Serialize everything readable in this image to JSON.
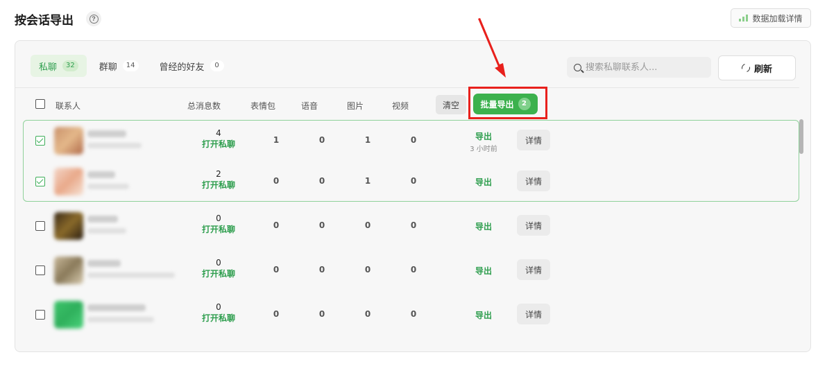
{
  "header": {
    "title": "按会话导出",
    "stats_label": "数据加载详情"
  },
  "tabs": [
    {
      "label": "私聊",
      "count": "32",
      "active": true
    },
    {
      "label": "群聊",
      "count": "14",
      "active": false
    },
    {
      "label": "曾经的好友",
      "count": "0",
      "active": false
    }
  ],
  "search": {
    "placeholder": "搜索私聊联系人..."
  },
  "refresh_label": "刷新",
  "columns": {
    "contact": "联系人",
    "total": "总消息数",
    "stickers": "表情包",
    "voice": "语音",
    "images": "图片",
    "video": "视频"
  },
  "actions": {
    "clear_label": "清空",
    "batch_export_label": "批量导出",
    "batch_count": "2"
  },
  "rows": [
    {
      "checked": true,
      "total": "4",
      "open_label": "打开私聊",
      "stickers": "1",
      "voice": "0",
      "images": "1",
      "video": "0",
      "export_label": "导出",
      "time": "3 小时前",
      "detail_label": "详情"
    },
    {
      "checked": true,
      "total": "2",
      "open_label": "打开私聊",
      "stickers": "0",
      "voice": "0",
      "images": "1",
      "video": "0",
      "export_label": "导出",
      "time": "",
      "detail_label": "详情"
    },
    {
      "checked": false,
      "total": "0",
      "open_label": "打开私聊",
      "stickers": "0",
      "voice": "0",
      "images": "0",
      "video": "0",
      "export_label": "导出",
      "time": "",
      "detail_label": "详情"
    },
    {
      "checked": false,
      "total": "0",
      "open_label": "打开私聊",
      "stickers": "0",
      "voice": "0",
      "images": "0",
      "video": "0",
      "export_label": "导出",
      "time": "",
      "detail_label": "详情"
    },
    {
      "checked": false,
      "total": "0",
      "open_label": "打开私聊",
      "stickers": "0",
      "voice": "0",
      "images": "0",
      "video": "0",
      "export_label": "导出",
      "time": "",
      "detail_label": "详情"
    }
  ],
  "colors": {
    "accent": "#3cb14d",
    "highlight": "#e8201c"
  },
  "icons": [
    "help-icon",
    "bar-chart-icon",
    "search-icon",
    "refresh-icon",
    "checkbox-icon",
    "arrow-annotation"
  ]
}
